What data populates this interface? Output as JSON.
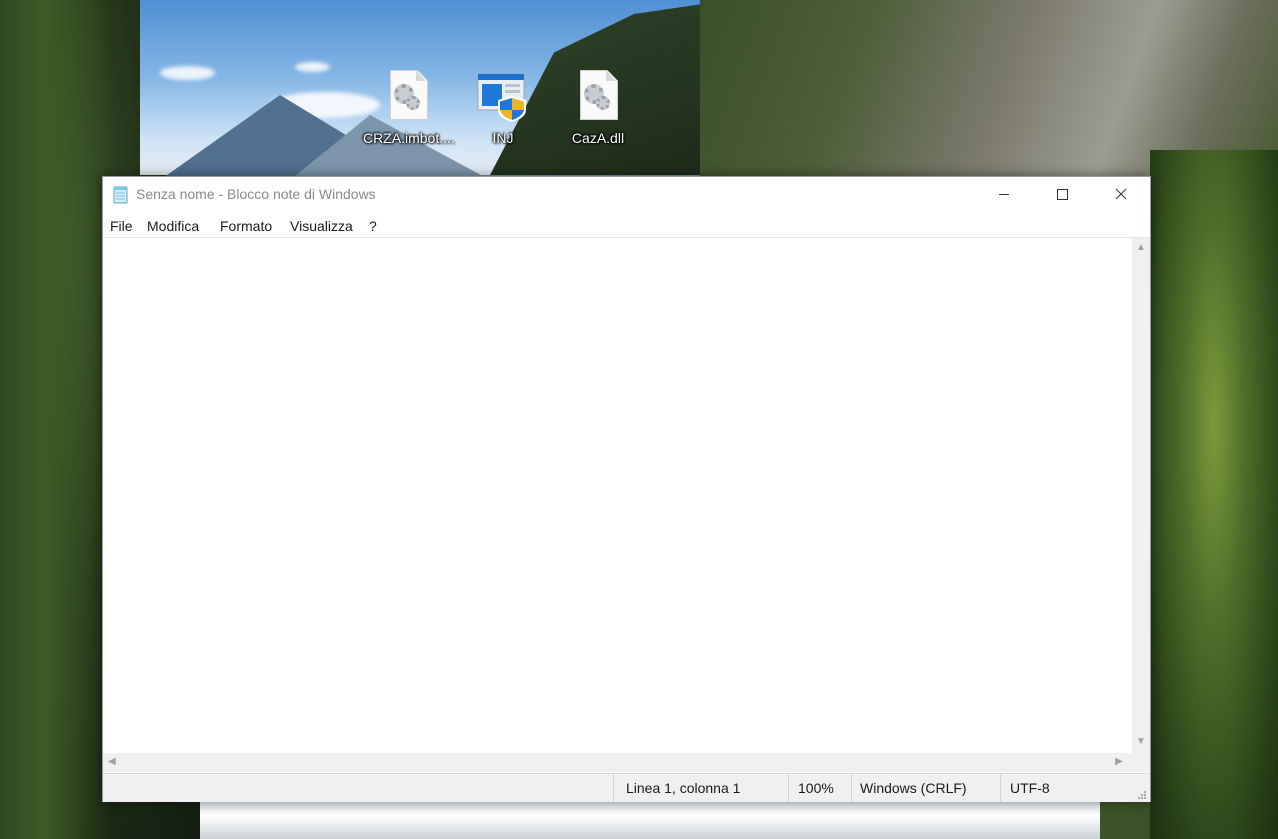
{
  "desktop": {
    "icons": [
      {
        "label": "CRZA.imbot....",
        "icon": "settings-file-icon"
      },
      {
        "label": "INJ",
        "icon": "installer-shield-icon"
      },
      {
        "label": "CazA.dll",
        "icon": "settings-file-icon"
      }
    ]
  },
  "window": {
    "title": "Senza nome - Blocco note di Windows",
    "app_icon": "notepad-icon",
    "controls": {
      "minimize": "minimize-icon",
      "maximize": "maximize-icon",
      "close": "close-icon"
    },
    "menu": [
      "File",
      "Modifica",
      "Formato",
      "Visualizza",
      "?"
    ],
    "editor_value": "",
    "status": {
      "position": "Linea 1, colonna 1",
      "zoom": "100%",
      "line_ending": "Windows (CRLF)",
      "encoding": "UTF-8"
    }
  },
  "colors": {
    "accent": "#0078d7",
    "title_text": "#8a8a8a",
    "statusbar": "#f0f0f0"
  }
}
